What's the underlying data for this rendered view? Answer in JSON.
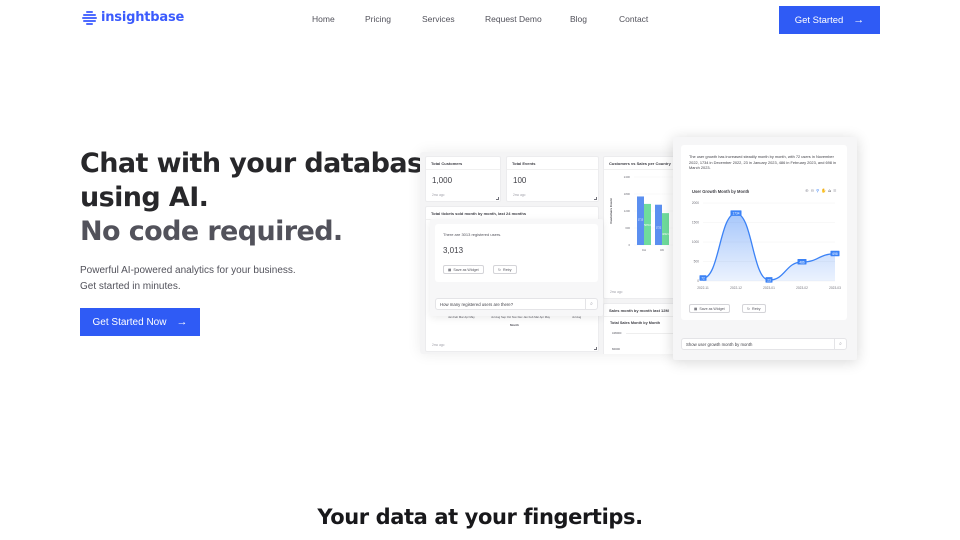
{
  "brand": {
    "name": "insightbase",
    "color": "#3b5bfd"
  },
  "nav": {
    "links": [
      "Home",
      "Pricing",
      "Services",
      "Request Demo",
      "Blog",
      "Contact"
    ],
    "cta": "Get Started",
    "cta_icon": "→"
  },
  "hero": {
    "title_line1": "Chat with your database",
    "title_line2": "using AI.",
    "title_line3": "No code required.",
    "sub_line1": "Powerful AI-powered analytics for your business.",
    "sub_line2": "Get started in minutes.",
    "cta": "Get Started Now",
    "cta_icon": "→"
  },
  "dashboard": {
    "total_customers": {
      "title": "Total Customers",
      "value": "1,000",
      "time": "2mo ago"
    },
    "total_events": {
      "title": "Total Events",
      "value": "100",
      "time": "2mo ago"
    },
    "tickets": {
      "title": "Total tickets sold month by month, last 24 months",
      "time": "2mo ago",
      "xlabel": "Month",
      "ticks": [
        "Jan Feb Mar Apr May",
        "Jul Aug Sep Oct Nov Dec Jan Feb Mar Apr May",
        "Jul Aug"
      ]
    },
    "country": {
      "title": "Customers vs Sales per Country",
      "ylabel": "Customers Count",
      "time": "2mo ago",
      "yticks": [
        "2400",
        "1800",
        "1200",
        "600",
        "0"
      ],
      "categories": [
        "CA",
        "UK",
        "F"
      ],
      "customers": [
        1713,
        1422,
        1800
      ],
      "sales": [
        1450,
        1125,
        1200
      ],
      "customer_labels": [
        "1713",
        "1722",
        "1100"
      ],
      "sales_labels": [
        "58716",
        "48021",
        "58"
      ],
      "customers_color": "#5b8ff0",
      "sales_color": "#6fdc9c"
    },
    "sales_12m": {
      "title": "Sales month by month last 12M",
      "chart_title": "Total Sales Month by Month",
      "yticks": [
        "1080000",
        "800000"
      ]
    }
  },
  "chat_popup": {
    "answer": "There are 3013 registered users.",
    "value": "3,013",
    "save_label": "Save as Widget",
    "retry_label": "Retry",
    "query": "How many registered users are there?"
  },
  "detail": {
    "summary": "The user growth has increased steadily month by month, with 72 users in November 2022, 1734 in December 2022, 23 in January 2023, 486 in February 2023, and 698 in March 2023.",
    "chart_title": "User Growth Month by Month",
    "save_label": "Save as Widget",
    "retry_label": "Retry",
    "query": "Show user growth month by month",
    "toolbar_icons": [
      "zoom-in-icon",
      "zoom-out-icon",
      "magnify-icon",
      "pan-icon",
      "home-icon",
      "menu-icon"
    ]
  },
  "chart_data": {
    "type": "area",
    "title": "User Growth Month by Month",
    "categories": [
      "2022-11",
      "2022-12",
      "2023-01",
      "2023-02",
      "2023-03"
    ],
    "values": [
      72,
      1734,
      23,
      486,
      698
    ],
    "yticks": [
      0,
      500,
      1000,
      1500,
      2000
    ],
    "ylim": [
      0,
      2000
    ],
    "color": "#3b82f6"
  },
  "section": {
    "title": "Your data at your fingertips."
  }
}
